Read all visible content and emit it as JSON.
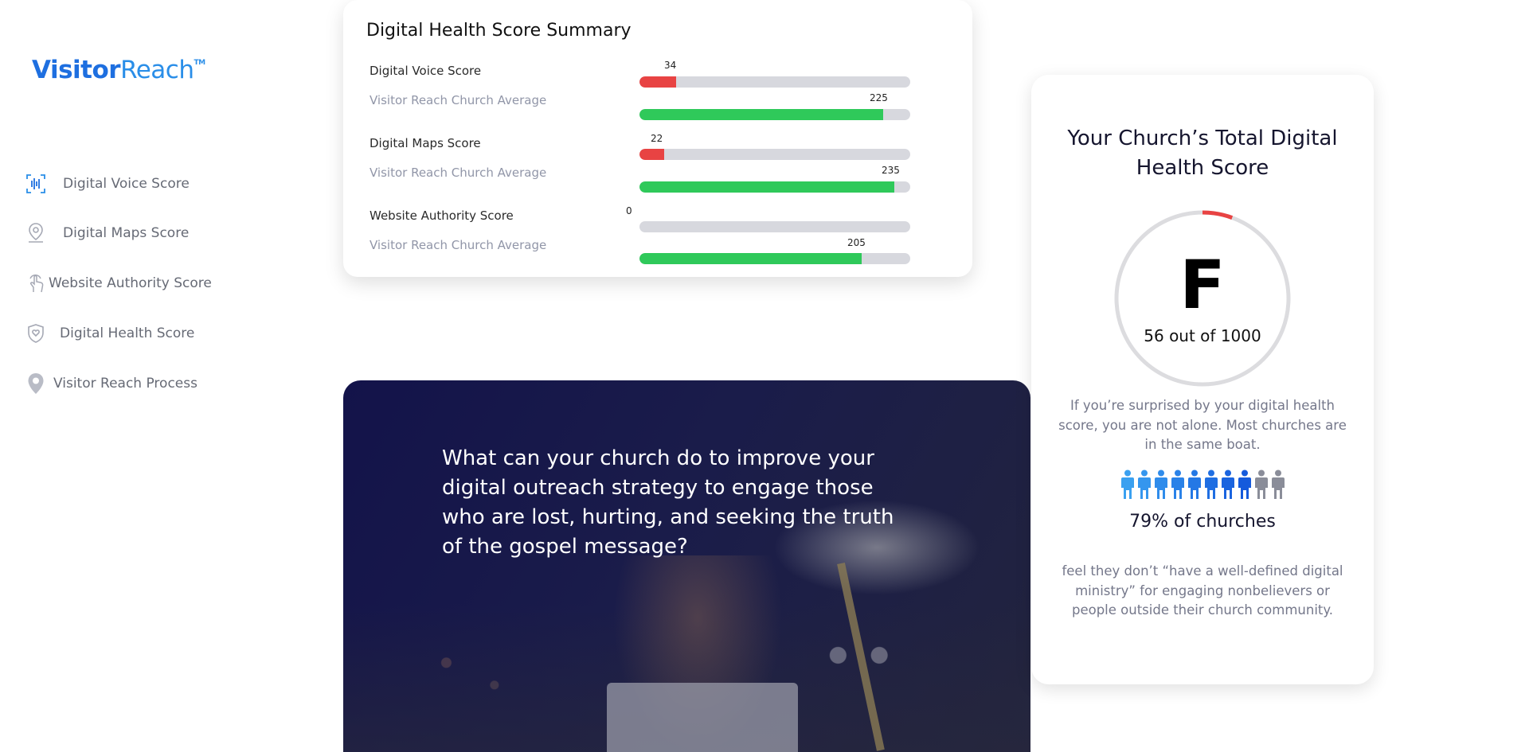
{
  "sidebar": {
    "logo": {
      "part1": "Visitor",
      "part2": "Reach",
      "tm": "TM"
    },
    "items": [
      {
        "label": "Digital Voice Score",
        "icon": "voice-wave-icon"
      },
      {
        "label": "Digital Maps Score",
        "icon": "map-pin-icon"
      },
      {
        "label": "Website Authority Score",
        "icon": "pointer-hand-icon"
      },
      {
        "label": "Digital Health Score",
        "icon": "shield-heart-icon"
      },
      {
        "label": "Visitor Reach Process",
        "icon": "location-pin-icon"
      }
    ]
  },
  "summary": {
    "title": "Digital Health Score Summary",
    "rows": [
      {
        "label": "Digital Voice Score",
        "value": "34",
        "fraction": 0.135,
        "type": "score"
      },
      {
        "label": "Visitor Reach Church Average",
        "value": "225",
        "fraction": 0.9,
        "type": "average"
      },
      {
        "label": "Digital Maps Score",
        "value": "22",
        "fraction": 0.09,
        "type": "score"
      },
      {
        "label": "Visitor Reach Church Average",
        "value": "235",
        "fraction": 0.94,
        "type": "average"
      },
      {
        "label": "Website Authority Score",
        "value": "0",
        "fraction": 0.0,
        "type": "score"
      },
      {
        "label": "Visitor Reach Church Average",
        "value": "205",
        "fraction": 0.82,
        "type": "average"
      }
    ]
  },
  "hero": {
    "question": "What can your church do to improve your digital outreach strategy to engage those who are lost, hurting, and seeking the truth of the gospel message?"
  },
  "score_card": {
    "title": "Your Church’s Total Digital Health Score",
    "grade": "F",
    "out_of": "56 out of 1000",
    "score_fraction": 0.056,
    "surprised_text": "If you’re surprised by your digital health score, you are not alone. Most churches are in the same boat.",
    "people_total": 10,
    "people_highlighted": 8,
    "percent_text": "79% of churches",
    "feel_text": "feel they don’t “have a well-defined digital ministry” for engaging nonbelievers or people outside their church community."
  },
  "colors": {
    "brand_blue": "#1e6fe0",
    "red": "#e84343",
    "green": "#2fc95a",
    "track": "#d7d8de",
    "navy": "#13134a"
  }
}
